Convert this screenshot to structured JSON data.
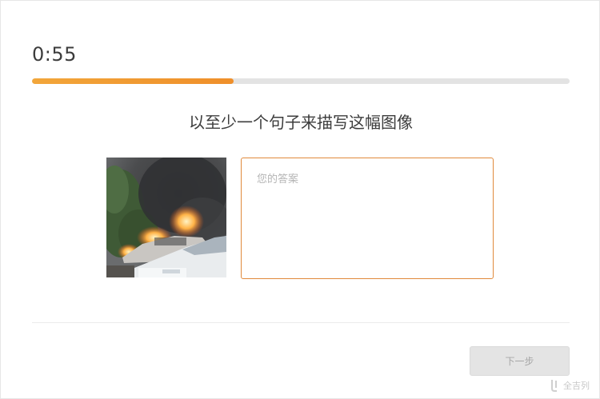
{
  "timer": "0:55",
  "progress": {
    "fraction": 0.375
  },
  "prompt": "以至少一个句子来描写这幅图像",
  "image": {
    "subject": "burning-car-photo"
  },
  "answer": {
    "placeholder": "您的答案",
    "value": ""
  },
  "next_button": {
    "label": "下一步"
  },
  "watermark": {
    "text": "全吉列"
  },
  "colors": {
    "accent": "#e08a3c",
    "progress_fill": "#f0992f",
    "track": "#e3e3e3",
    "button_bg": "#e4e4e4"
  }
}
